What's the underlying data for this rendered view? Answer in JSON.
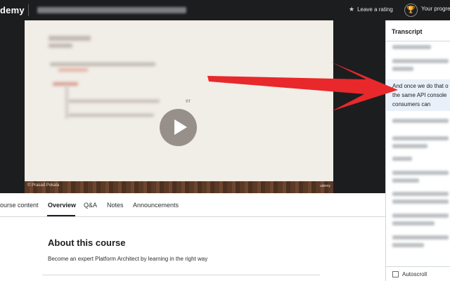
{
  "header": {
    "brand": "demy",
    "leave_rating": "Leave a rating",
    "progress": "Your progress",
    "icons": {
      "rating": "star-icon",
      "progress": "trophy-icon"
    }
  },
  "video": {
    "footer_author": "© Prasad Pokala",
    "footer_logo": "udemy",
    "slide_fragment": "er",
    "play_icon": "play-icon"
  },
  "tabs": [
    {
      "label": "ourse content",
      "active": false
    },
    {
      "label": "Overview",
      "active": true
    },
    {
      "label": "Q&A",
      "active": false
    },
    {
      "label": "Notes",
      "active": false
    },
    {
      "label": "Announcements",
      "active": false
    }
  ],
  "about": {
    "title": "About this course",
    "description": "Become an expert Platform Architect by learning in the right way"
  },
  "transcript": {
    "title": "Transcript",
    "current_lines": [
      "And once we do that o",
      "the same API console",
      "consumers can"
    ],
    "autoscroll_label": "Autoscroll",
    "autoscroll_checked": false
  },
  "colors": {
    "header_bg": "#1c1d1f",
    "arrow": "#e8282b",
    "highlight": "#e9f0f9"
  }
}
